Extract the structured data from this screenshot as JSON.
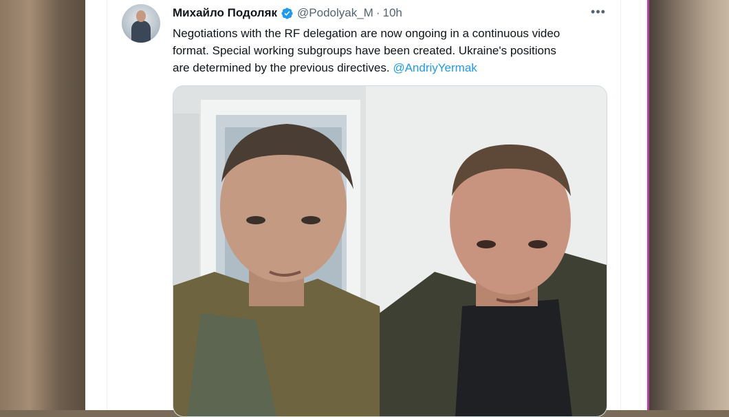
{
  "tweet": {
    "display_name": "Михайло Подоляк",
    "handle": "@Podolyak_M",
    "separator": "·",
    "time": "10h",
    "more": "•••",
    "text_line1": "Negotiations with the RF delegation are now ongoing in a continuous video",
    "text_line2": "format. Special working subgroups have been created. Ukraine's positions",
    "text_line3": "are determined by the previous directives. ",
    "mention": "@AndriyYermak"
  },
  "colors": {
    "link": "#1d9bf0",
    "verified": "#1d9bf0",
    "text": "#0f1419",
    "secondary": "#536471"
  },
  "icons": {
    "verified": "verified-badge-icon",
    "more": "more-horizontal-icon"
  }
}
